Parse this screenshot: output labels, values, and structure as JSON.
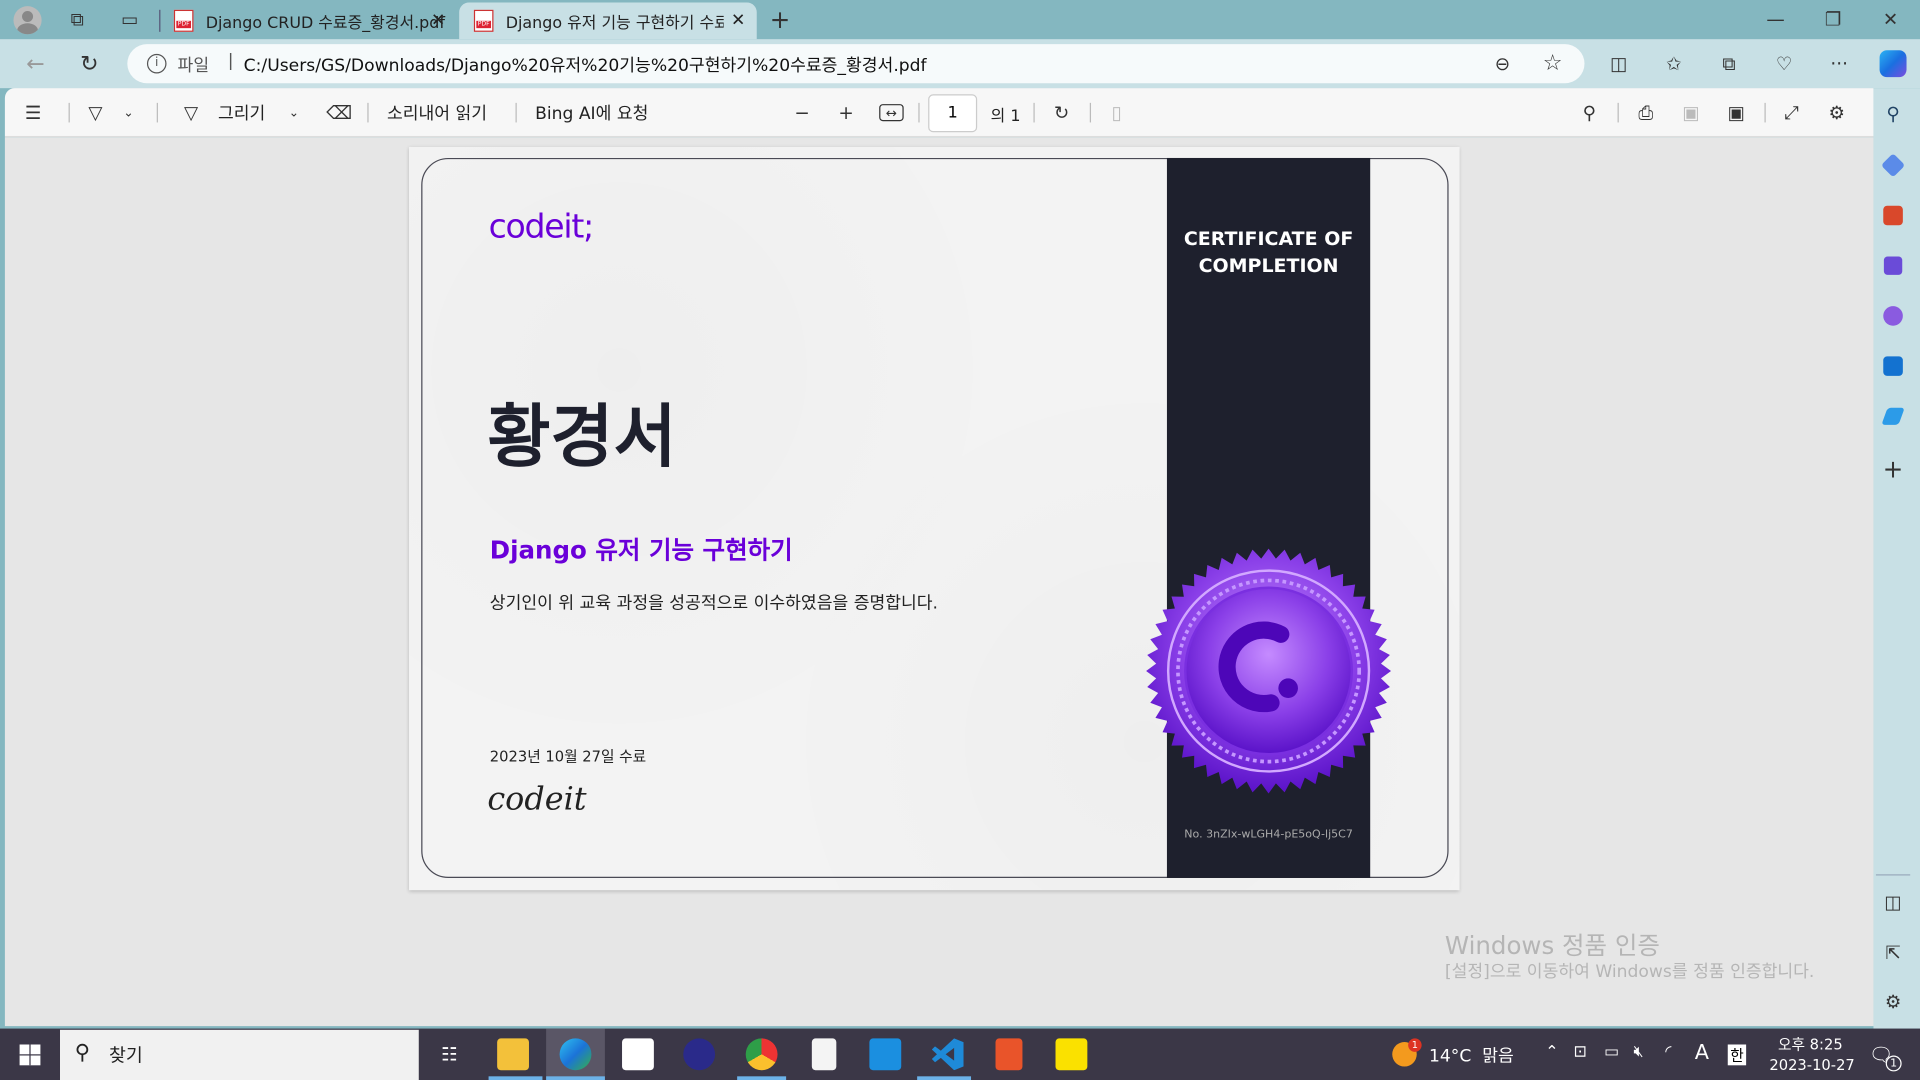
{
  "browser": {
    "tabs": [
      {
        "label": "Django CRUD 수료증_황경서.pdf",
        "active": false
      },
      {
        "label": "Django 유저 기능 구현하기 수료증",
        "active": true
      }
    ],
    "address": {
      "scheme_label": "파일",
      "url": "C:/Users/GS/Downloads/Django%20유저%20기능%20구현하기%20수료증_황경서.pdf"
    },
    "window_controls": [
      "minimize",
      "restore",
      "close"
    ]
  },
  "pdf_toolbar": {
    "draw_label": "그리기",
    "read_aloud_label": "소리내어 읽기",
    "bing_label": "Bing AI에 요청",
    "page_current": "1",
    "page_total_label": "의 1"
  },
  "certificate": {
    "logo": "codeit;",
    "name": "황경서",
    "course": "Django 유저 기능 구현하기",
    "statement": "상기인이 위 교육 과정을 성공적으로 이수하였음을 증명합니다.",
    "date": "2023년 10월 27일 수료",
    "signature": "codeit",
    "banner_title": "CERTIFICATE OF COMPLETION",
    "serial": "No. 3nZIx-wLGH4-pE5oQ-lj5C7",
    "accent_color": "#6a00d9",
    "band_color": "#1e202d"
  },
  "watermark": {
    "title": "Windows 정품 인증",
    "subtitle": "[설정]으로 이동하여 Windows를 정품 인증합니다."
  },
  "taskbar": {
    "search_placeholder": "찾기",
    "weather": "14°C  맑음",
    "weather_badge": "1",
    "ime_a": "A",
    "ime_lang": "한",
    "time": "오후 8:25",
    "date": "2023-10-27",
    "notification_count": "1",
    "apps": [
      "task-view",
      "file-explorer",
      "edge",
      "microsoft-store",
      "app",
      "chrome",
      "notepad",
      "mail",
      "vscode",
      "ubuntu",
      "kakaotalk"
    ]
  }
}
